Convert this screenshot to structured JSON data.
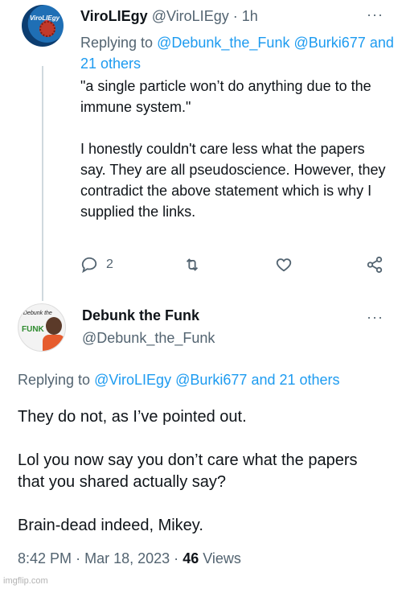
{
  "tweet1": {
    "name": "ViroLIEgy",
    "handle": "@ViroLIEgy",
    "sep": "·",
    "time": "1h",
    "avatar_text": "ViroLIEgy",
    "reply_prefix": "Replying to",
    "reply_mention1": "@Debunk_the_Funk",
    "reply_mention2": "@Burki677",
    "reply_others": "and 21 others",
    "paragraphs": [
      "\"a single particle won’t do anything due to the immune system.\"",
      "I honestly couldn't care less what the papers say. They are all pseudoscience. However, they contradict the above statement which is why I supplied the links."
    ],
    "reply_count": "2",
    "more": "···"
  },
  "tweet2": {
    "name": "Debunk the Funk",
    "handle": "@Debunk_the_Funk",
    "avatar_text_top": "Debunk the",
    "avatar_text_funk": "FUNK",
    "reply_prefix": "Replying to",
    "reply_mention1": "@ViroLIEgy",
    "reply_mention2": "@Burki677",
    "reply_others": "and 21 others",
    "paragraphs": [
      "They do not, as I’ve pointed out.",
      "Lol you now say you don’t care what the papers that you shared actually say?",
      "Brain-dead indeed, Mikey."
    ],
    "time": "8:42 PM",
    "sep1": "·",
    "date": "Mar 18, 2023",
    "sep2": "·",
    "views_count": "46",
    "views_label": "Views",
    "more": "···"
  },
  "watermark": "imgflip.com",
  "colors": {
    "link": "#1d9bf0",
    "muted": "#536471",
    "text": "#0f1419"
  },
  "icons": [
    "reply-icon",
    "retweet-icon",
    "like-icon",
    "share-icon",
    "more-icon"
  ]
}
